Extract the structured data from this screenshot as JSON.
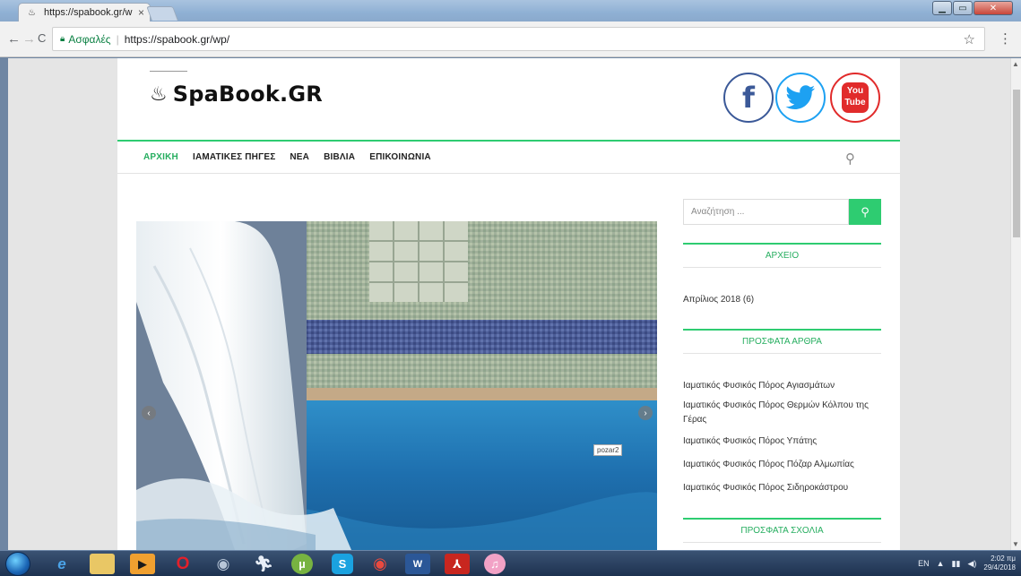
{
  "browser": {
    "tab_title": "https://spabook.gr/wp/",
    "tab_close": "×",
    "secure_label": "Ασφαλές",
    "separator": "|",
    "url": "https://spabook.gr/wp/",
    "bookmark_icon": "star-icon",
    "menu_icon": "kebab-menu-icon",
    "window_controls": [
      "minimize",
      "maximize",
      "close"
    ]
  },
  "site": {
    "logo_text": "SpaBook.GR",
    "logo_icon": "hot-spring-icon",
    "social": [
      {
        "name": "facebook",
        "label": "f",
        "color": "#3b5998"
      },
      {
        "name": "twitter",
        "label": "",
        "color": "#1da1f2"
      },
      {
        "name": "youtube",
        "label_top": "You",
        "label_bottom": "Tube",
        "color": "#e12b2b"
      }
    ],
    "accent_color": "#2ecc71"
  },
  "nav": {
    "items": [
      "ΑΡΧΙΚΗ",
      "ΙΑΜΑΤΙΚΕΣ ΠΗΓΕΣ",
      "ΝΕΑ",
      "ΒΙΒΛΙΑ",
      "ΕΠΙΚΟΙΝΩΝΙΑ"
    ],
    "active_index": 0
  },
  "slider": {
    "caption": "pozar2",
    "prev_label": "‹",
    "next_label": "›"
  },
  "sidebar": {
    "search_placeholder": "Αναζήτηση ...",
    "archive_title": "ΑΡΧΕΙΟ",
    "archive_items": [
      "Απρίλιος 2018 (6)"
    ],
    "recent_posts_title": "ΠΡΟΣΦΑΤΑ ΑΡΘΡΑ",
    "recent_posts": [
      "Ιαματικός Φυσικός Πόρος Αγιασμάτων",
      "Ιαματικός Φυσικός Πόρος Θερμών Κόλπου της Γέρας",
      "Ιαματικός Φυσικός Πόρος Υπάτης",
      "Ιαματικός Φυσικός Πόρος Πόζαρ Αλμωπίας",
      "Ιαματικός Φυσικός Πόρος Σιδηροκάστρου"
    ],
    "recent_comments_title": "ΠΡΟΣΦΑΤΑ ΣΧΟΛΙΑ"
  },
  "taskbar": {
    "apps": [
      "ie-icon",
      "explorer-icon",
      "media-player-icon",
      "opera-icon",
      "chrome-canary-icon",
      "runner-app-icon",
      "utorrent-icon",
      "skype-icon",
      "chrome-icon",
      "word-icon",
      "acrobat-icon",
      "itunes-icon"
    ],
    "language": "EN",
    "time": "2:02 πμ",
    "date": "29/4/2018"
  }
}
